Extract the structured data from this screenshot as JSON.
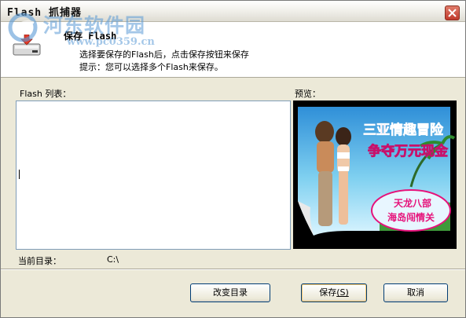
{
  "window": {
    "title": "Flash 抓捕器"
  },
  "watermark": {
    "site_name": "河东软件园",
    "url": "www.pc0359.cn"
  },
  "header": {
    "title": "保存 Flash",
    "line1": "选择要保存的Flash后，点击保存按钮来保存",
    "line2": "提示：您可以选择多个Flash来保存。"
  },
  "main": {
    "list_label": "Flash 列表：",
    "preview_label": "预览：",
    "preview_image": {
      "title_line1": "三亚情趣冒险",
      "title_line2": "争夺万元现金",
      "badge_line1": "天龙八部",
      "badge_line2": "海岛闯情关"
    },
    "current_dir_label": "当前目录：",
    "current_dir_value": "C:\\"
  },
  "buttons": {
    "change_dir": "改变目录",
    "save": "保存",
    "save_hotkey": "(S)",
    "cancel": "取消"
  },
  "icons": {
    "close": "close-icon",
    "header": "save-drive-icon",
    "watermark_logo": "globe-logo-icon"
  },
  "colors": {
    "titlebar_close": "#c0392b",
    "watermark": "#5b9bd6",
    "dialog_bg": "#ece9d8",
    "list_border": "#7f9db9"
  }
}
